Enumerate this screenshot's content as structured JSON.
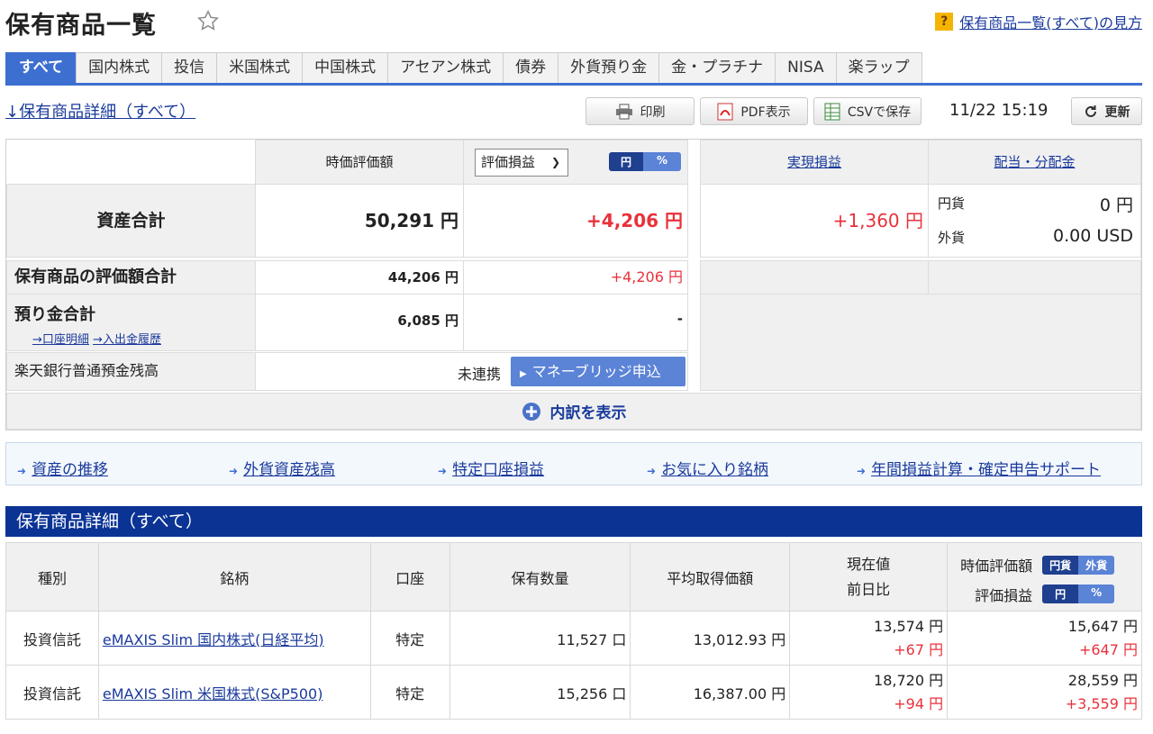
{
  "page": {
    "title": "保有商品一覧",
    "help_text": "保有商品一覧(すべて)の見方"
  },
  "tabs": [
    {
      "label": "すべて"
    },
    {
      "label": "国内株式"
    },
    {
      "label": "投信"
    },
    {
      "label": "米国株式"
    },
    {
      "label": "中国株式"
    },
    {
      "label": "アセアン株式"
    },
    {
      "label": "債券"
    },
    {
      "label": "外貨預り金"
    },
    {
      "label": "金・プラチナ"
    },
    {
      "label": "NISA"
    },
    {
      "label": "楽ラップ"
    }
  ],
  "toolbar": {
    "detail_link": "↓保有商品詳細（すべて）",
    "print": "印刷",
    "pdf": "PDF表示",
    "csv": "CSVで保存",
    "timestamp": "11/22 15:19",
    "refresh": "更新"
  },
  "summary": {
    "col_market_value": "時価評価額",
    "select_value": "評価損益",
    "toggle": {
      "yen": "円",
      "pct": "%"
    },
    "col_realized": "実現損益",
    "col_dividend": "配当・分配金",
    "total": {
      "label": "資産合計",
      "value": "50,291 円",
      "pl": "+4,206 円",
      "realized": "+1,360 円"
    },
    "dividend": {
      "jpy_label": "円貨",
      "jpy_value": "0 円",
      "fx_label": "外貨",
      "fx_value": "0.00 USD"
    },
    "holdings": {
      "label": "保有商品の評価額合計",
      "value": "44,206 円",
      "pl": "+4,206 円"
    },
    "deposit": {
      "label": "預り金合計",
      "link1": "→口座明細",
      "link2": "→入出金履歴",
      "value": "6,085 円",
      "pl": "-"
    },
    "bank": {
      "label": "楽天銀行普通預金残高",
      "status": "未連携",
      "button": "マネーブリッジ申込"
    },
    "expand": "内訳を表示"
  },
  "links": [
    "資産の推移",
    "外貨資産残高",
    "特定口座損益",
    "お気に入り銘柄",
    "年間損益計算・確定申告サポート"
  ],
  "detail": {
    "header": "保有商品詳細（すべて）",
    "columns": {
      "type": "種別",
      "name": "銘柄",
      "account": "口座",
      "qty": "保有数量",
      "avg": "平均取得価額",
      "price": "現在値",
      "change": "前日比",
      "mv": "時価評価額",
      "pl": "評価損益",
      "toggle_mv": {
        "jpy": "円貨",
        "fx": "外貨"
      },
      "toggle_pl": {
        "yen": "円",
        "pct": "%"
      }
    },
    "rows": [
      {
        "type": "投資信託",
        "name": "eMAXIS Slim 国内株式(日経平均)",
        "account": "特定",
        "qty": "11,527 口",
        "avg": "13,012.93 円",
        "price": "13,574 円",
        "change": "+67 円",
        "mv": "15,647 円",
        "pl": "+647 円"
      },
      {
        "type": "投資信託",
        "name": "eMAXIS Slim 米国株式(S&P500)",
        "account": "特定",
        "qty": "15,256 口",
        "avg": "16,387.00 円",
        "price": "18,720 円",
        "change": "+94 円",
        "mv": "28,559 円",
        "pl": "+3,559 円"
      }
    ]
  },
  "colors": {
    "accent": "#3d6fd0",
    "header_navy": "#0a3394",
    "positive": "#e8323c"
  }
}
